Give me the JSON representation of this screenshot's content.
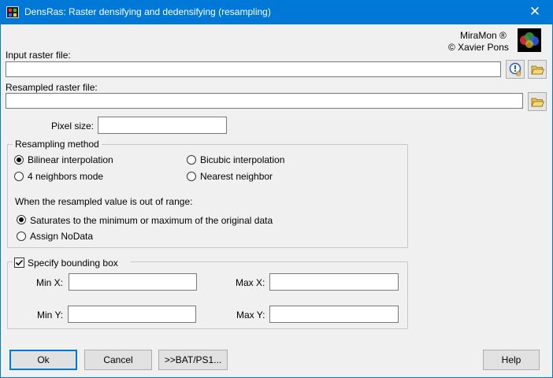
{
  "window": {
    "title": "DensRas: Raster densifying and dedensifying (resampling)",
    "close_glyph": "✕"
  },
  "brand": {
    "line1": "MiraMon ®",
    "line2": "© Xavier Pons"
  },
  "input_raster": {
    "label": "Input raster file:",
    "value": ""
  },
  "resampled_raster": {
    "label": "Resampled raster file:",
    "value": ""
  },
  "pixel_size": {
    "label": "Pixel size:",
    "value": ""
  },
  "resampling": {
    "legend": "Resampling method",
    "options": [
      {
        "label": "Bilinear interpolation",
        "selected": true
      },
      {
        "label": "Bicubic interpolation",
        "selected": false
      },
      {
        "label": "4 neighbors mode",
        "selected": false
      },
      {
        "label": "Nearest neighbor",
        "selected": false
      }
    ],
    "out_of_range_label": "When the resampled value is out of range:",
    "range_options": [
      {
        "label": "Saturates to the minimum or maximum of the original data",
        "selected": true
      },
      {
        "label": "Assign NoData",
        "selected": false
      }
    ]
  },
  "bounding_box": {
    "label": "Specify bounding box",
    "checked": true,
    "min_x_label": "Min X:",
    "max_x_label": "Max X:",
    "min_y_label": "Min Y:",
    "max_y_label": "Max Y:",
    "min_x": "",
    "max_x": "",
    "min_y": "",
    "max_y": ""
  },
  "buttons": {
    "ok": "Ok",
    "cancel": "Cancel",
    "bat": ">>BAT/PS1...",
    "help": "Help"
  },
  "colors": {
    "titlebar": "#0078d7",
    "accent": "#0078d7",
    "folder": "#e8c050"
  }
}
